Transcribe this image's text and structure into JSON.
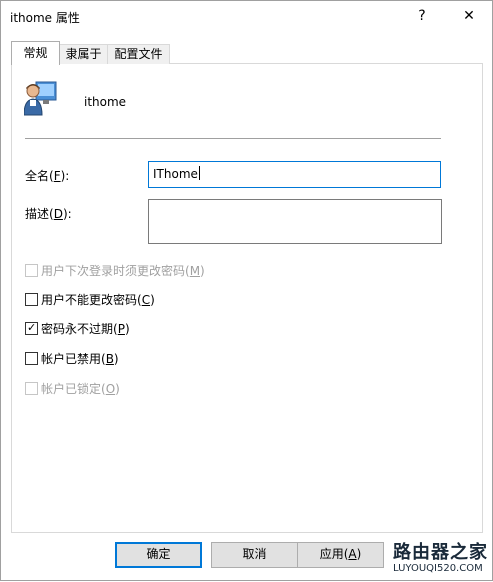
{
  "window": {
    "title": "ithome 属性",
    "help_glyph": "?",
    "close_glyph": "✕"
  },
  "tabs": [
    {
      "label": "常规",
      "active": true
    },
    {
      "label": "隶属于",
      "active": false
    },
    {
      "label": "配置文件",
      "active": false
    }
  ],
  "user": {
    "name": "ithome"
  },
  "fields": {
    "fullname": {
      "label_pre": "全名(",
      "accel": "F",
      "label_post": "):",
      "value": "IThome"
    },
    "description": {
      "label_pre": "描述(",
      "accel": "D",
      "label_post": "):",
      "value": ""
    }
  },
  "checkboxes": [
    {
      "pre": "用户下次登录时须更改密码(",
      "accel": "M",
      "post": ")",
      "checked": false,
      "disabled": true
    },
    {
      "pre": "用户不能更改密码(",
      "accel": "C",
      "post": ")",
      "checked": false,
      "disabled": false
    },
    {
      "pre": "密码永不过期(",
      "accel": "P",
      "post": ")",
      "checked": true,
      "disabled": false
    },
    {
      "pre": "帐户已禁用(",
      "accel": "B",
      "post": ")",
      "checked": false,
      "disabled": false
    },
    {
      "pre": "帐户已锁定(",
      "accel": "O",
      "post": ")",
      "checked": false,
      "disabled": true
    }
  ],
  "buttons": {
    "ok": "确定",
    "cancel": "取消",
    "apply_pre": "应用(",
    "apply_accel": "A",
    "apply_post": ")"
  },
  "watermark": {
    "big": "路由器之家",
    "small": "LUYOUQI520.COM"
  },
  "colors": {
    "focus": "#0078d7",
    "disabled_text": "#a0a0a0"
  }
}
